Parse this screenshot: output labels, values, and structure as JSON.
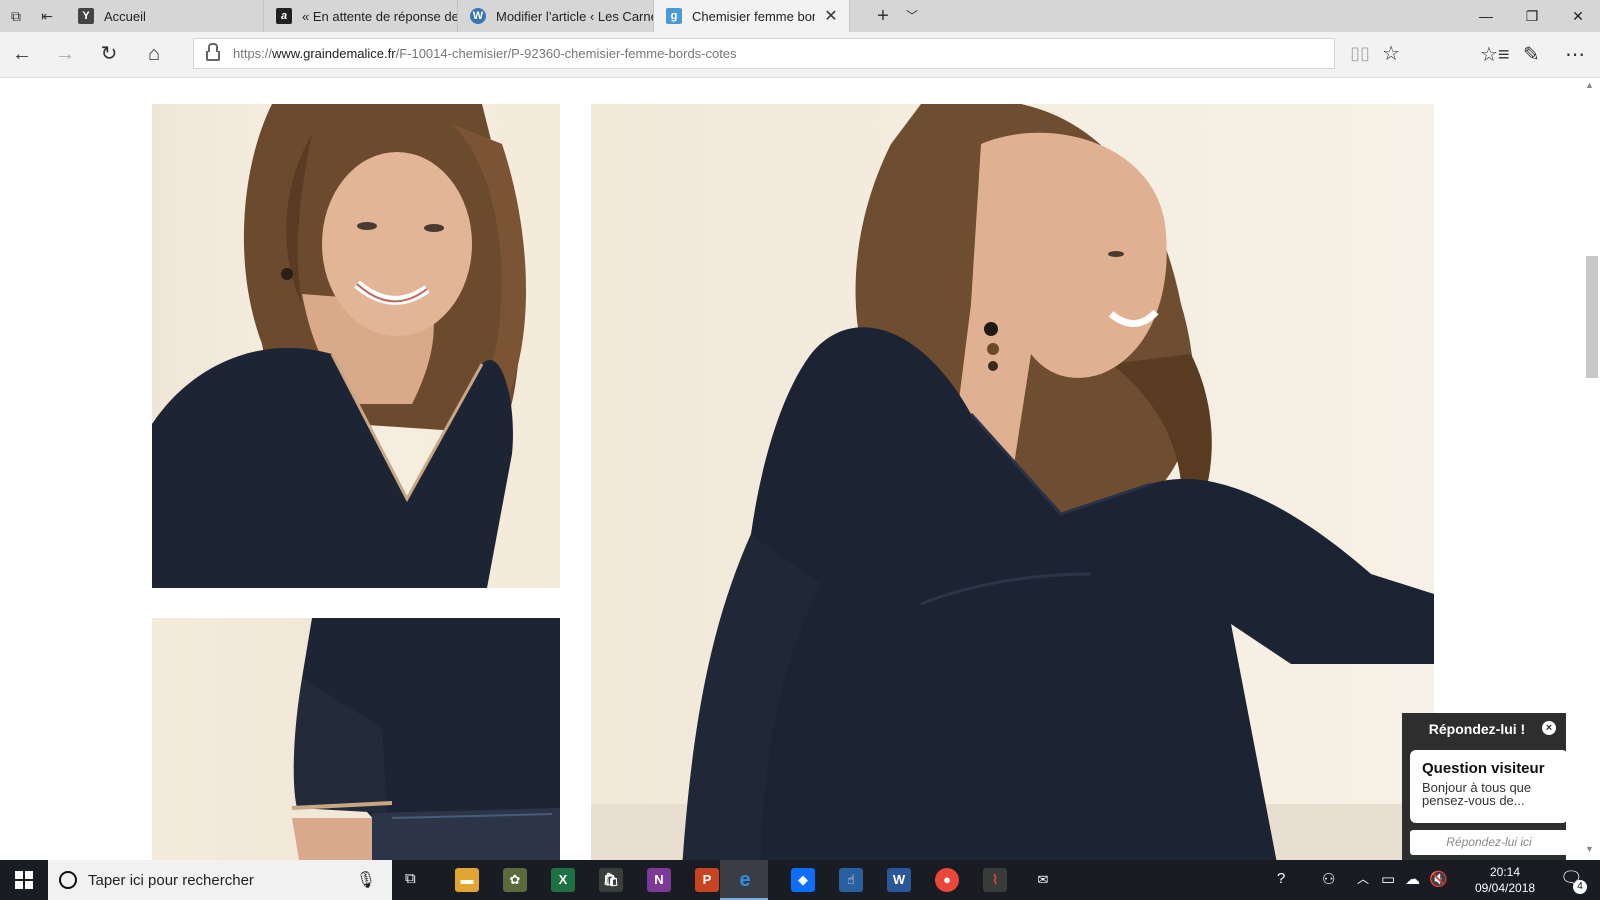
{
  "browser": {
    "tabs": [
      {
        "label": "Accueil",
        "favicon": "Y"
      },
      {
        "label": "« En attente de réponse de",
        "favicon": "a"
      },
      {
        "label": "Modifier l’article ‹ Les Carne",
        "favicon": "W"
      },
      {
        "label": "Chemisier femme bords",
        "favicon": "g",
        "active": true
      }
    ],
    "url": {
      "scheme": "https://",
      "domain": "www.graindemalice.fr",
      "path": "/F-10014-chemisier/P-92360-chemisier-femme-bords-cotes"
    }
  },
  "page": {
    "photos": [
      {
        "description_icon": "woman-portrait-photo"
      },
      {
        "description_icon": "blouse-sleeve-detail-photo"
      },
      {
        "description_icon": "woman-seated-blouse-photo"
      }
    ],
    "scroll_position": 0.23
  },
  "chat": {
    "title": "Répondez-lui !",
    "question_title": "Question visiteur",
    "message": "Bonjour à tous que pensez-vous de...",
    "reply_placeholder": "Répondez-lui ici"
  },
  "taskbar": {
    "search_placeholder": "Taper ici pour rechercher",
    "time": "20:14",
    "date": "09/04/2018",
    "notification_count": "4",
    "colors": {
      "background": "#1a1c24",
      "accent": "#7aaede"
    }
  }
}
